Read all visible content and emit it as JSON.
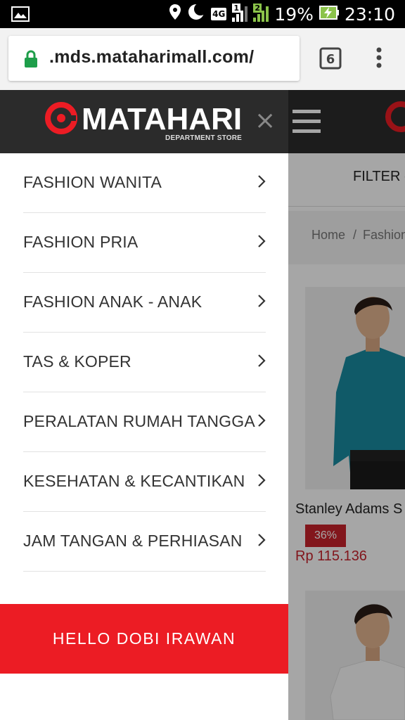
{
  "status_bar": {
    "network": "4G",
    "sim1": "1",
    "sim2": "2",
    "battery": "19%",
    "time": "23:10"
  },
  "browser": {
    "url": ".mds.mataharimall.com/"
  },
  "drawer": {
    "logo_text": "MATAHARI",
    "logo_subtext": "DEPARTMENT STORE",
    "close_glyph": "×",
    "menu": [
      {
        "label": "FASHION WANITA"
      },
      {
        "label": "FASHION PRIA"
      },
      {
        "label": "FASHION ANAK - ANAK"
      },
      {
        "label": "TAS & KOPER"
      },
      {
        "label": "PERALATAN RUMAH TANGGA"
      },
      {
        "label": "KESEHATAN & KECANTIKAN"
      },
      {
        "label": "JAM TANGAN & PERHIASAN"
      }
    ],
    "hello_button": "HELLO DOBI IRAWAN"
  },
  "background_page": {
    "filter_label": "FILTER -",
    "breadcrumb": [
      "Home",
      "/",
      "Fashion"
    ],
    "product": {
      "name": "Stanley Adams S",
      "discount": "36%",
      "price": "Rp 115.136"
    }
  },
  "colors": {
    "brand_red": "#ec1c24",
    "header_dark": "#2b2b2b",
    "price_red": "#c8232c"
  }
}
